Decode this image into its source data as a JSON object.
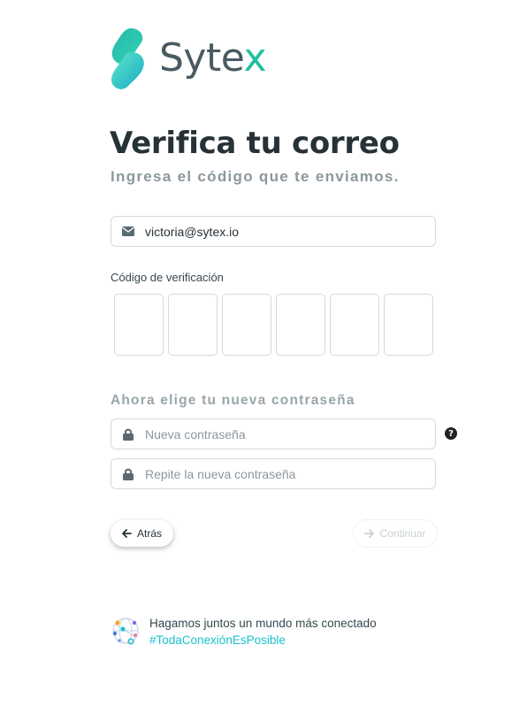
{
  "brand": {
    "name_main": "Syte",
    "name_accent": "x"
  },
  "heading": {
    "title": "Verifica tu correo",
    "subtitle": "Ingresa el código que te enviamos."
  },
  "email_field": {
    "value": "victoria@sytex.io",
    "icon": "envelope-icon"
  },
  "verification": {
    "label": "Código de verificación",
    "box_count": 6
  },
  "password_section": {
    "title": "Ahora elige tu nueva contraseña",
    "new_placeholder": "Nueva contraseña",
    "repeat_placeholder": "Repite la nueva contraseña",
    "help_icon": "question-circle-icon",
    "lock_icon": "lock-icon"
  },
  "actions": {
    "back_label": "Atrás",
    "continue_label": "Continuar"
  },
  "footer": {
    "line1": "Hagamos juntos un mundo más conectado",
    "hashtag": "#TodaConexiónEsPosible"
  },
  "colors": {
    "brand_teal": "#20c0a0",
    "hashtag": "#19c3d0",
    "title": "#263238",
    "muted": "#8b979d"
  }
}
